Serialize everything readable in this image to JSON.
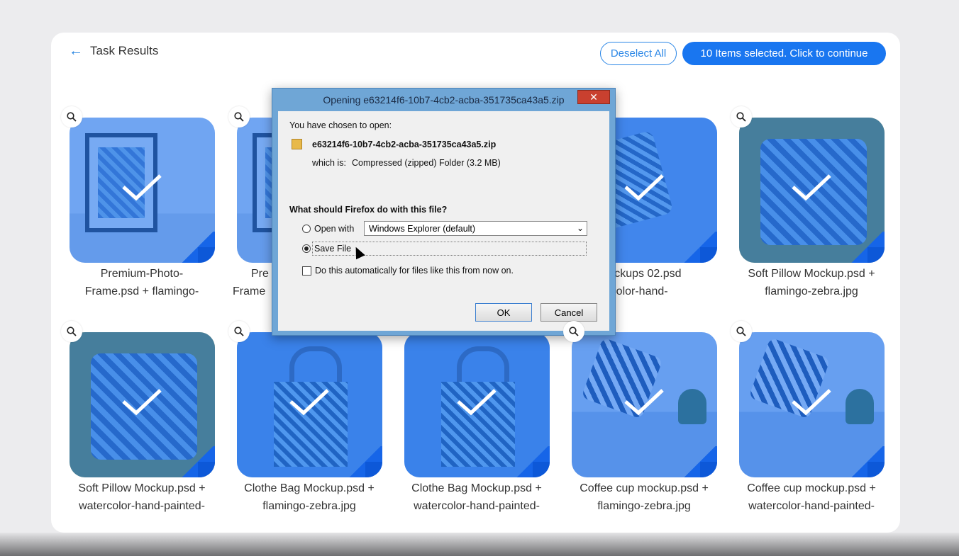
{
  "header": {
    "back_title": "Task Results",
    "deselect_label": "Deselect All",
    "continue_label": "10 Items selected. Click to continue"
  },
  "cards": [
    {
      "caption_1": "Premium-Photo-",
      "caption_2": "Frame.psd + flamingo-"
    },
    {
      "caption_1": "Pre",
      "caption_2": "Frame"
    },
    {
      "caption_1": "",
      "caption_2": ""
    },
    {
      "caption_1": "Mockups 02.psd",
      "caption_2": "tercolor-hand-"
    },
    {
      "caption_1": "Soft Pillow Mockup.psd +",
      "caption_2": "flamingo-zebra.jpg"
    },
    {
      "caption_1": "Soft Pillow Mockup.psd +",
      "caption_2": "watercolor-hand-painted-"
    },
    {
      "caption_1": "Clothe Bag Mockup.psd +",
      "caption_2": "flamingo-zebra.jpg"
    },
    {
      "caption_1": "Clothe Bag Mockup.psd +",
      "caption_2": "watercolor-hand-painted-"
    },
    {
      "caption_1": "Coffee cup mockup.psd +",
      "caption_2": "flamingo-zebra.jpg"
    },
    {
      "caption_1": "Coffee cup mockup.psd +",
      "caption_2": "watercolor-hand-painted-"
    }
  ],
  "dialog": {
    "title": "Opening e63214f6-10b7-4cb2-acba-351735ca43a5.zip",
    "close_glyph": "✕",
    "intro": "You have chosen to open:",
    "filename": "e63214f6-10b7-4cb2-acba-351735ca43a5.zip",
    "which_is_label": "which is:",
    "which_is_value": "Compressed (zipped) Folder (3.2 MB)",
    "question": "What should Firefox do with this file?",
    "open_with_label": "Open with",
    "open_with_value": "Windows Explorer (default)",
    "save_file_label": "Save File",
    "auto_label": "Do this automatically for files like this from now on.",
    "ok_label": "OK",
    "cancel_label": "Cancel",
    "selected_option": "Save File"
  },
  "colors": {
    "accent": "#1976f0",
    "overlay": "#2076f0"
  }
}
